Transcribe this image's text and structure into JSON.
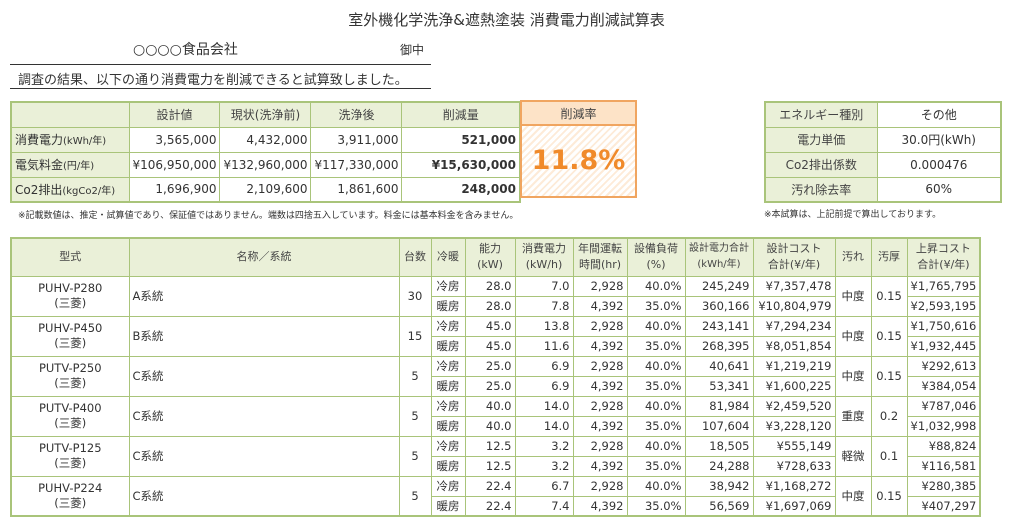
{
  "header": {
    "title": "室外機化学洗浄&遮熱塗装 消費電力削減試算表",
    "company": "○○○○食品会社",
    "onchu": "御中",
    "intro": "調査の結果、以下の通り消費電力を削減できると試算致しました。"
  },
  "summary": {
    "headers": [
      "設計値",
      "現状(洗浄前)",
      "洗浄後",
      "削減量"
    ],
    "rate_label": "削減率",
    "rate_value": "11.8%",
    "rows": [
      {
        "label": "消費電力",
        "unit": "(kWh/年)",
        "design": "3,565,000",
        "before": "4,432,000",
        "after": "3,911,000",
        "reduction": "521,000"
      },
      {
        "label": "電気料金",
        "unit": "(円/年)",
        "design": "¥106,950,000",
        "before": "¥132,960,000",
        "after": "¥117,330,000",
        "reduction": "¥15,630,000"
      },
      {
        "label": "Co2排出",
        "unit": "(kgCo2/年)",
        "design": "1,696,900",
        "before": "2,109,600",
        "after": "1,861,600",
        "reduction": "248,000"
      }
    ],
    "note": "※記載数値は、推定・試算値であり、保証値ではありません。端数は四捨五入しています。料金には基本料金を含みません。"
  },
  "energy": {
    "rows": [
      {
        "label": "エネルギー種別",
        "value": "その他"
      },
      {
        "label": "電力単価",
        "value": "30.0円(kWh)"
      },
      {
        "label": "Co2排出係数",
        "value": "0.000476"
      },
      {
        "label": "汚れ除去率",
        "value": "60%"
      }
    ],
    "note": "※本試算は、上記前提で算出しております。"
  },
  "detail": {
    "headers": {
      "model": "型式",
      "name": "名称／系統",
      "count": "台数",
      "mode": "冷暖",
      "capacity": "能力(kW)",
      "power": "消費電力(kW/h)",
      "hours": "年間運転時間(hr)",
      "load": "設備負荷(%)",
      "design_kwh": "設計電力合計(kWh/年)",
      "design_cost": "設計コスト合計(¥/年)",
      "dirt": "汚れ",
      "thickness": "汚厚",
      "increase": "上昇コスト合計(¥/年)"
    },
    "units": [
      {
        "model": "PUHV-P280",
        "maker": "(三菱)",
        "name": "A系統",
        "count": "30",
        "dirt": "中度",
        "thickness": "0.15",
        "rows": [
          {
            "mode": "冷房",
            "cap": "28.0",
            "power": "7.0",
            "hours": "2,928",
            "load": "40.0%",
            "kwh": "245,249",
            "cost": "¥7,357,478",
            "inc": "¥1,765,795"
          },
          {
            "mode": "暖房",
            "cap": "28.0",
            "power": "7.8",
            "hours": "4,392",
            "load": "35.0%",
            "kwh": "360,166",
            "cost": "¥10,804,979",
            "inc": "¥2,593,195"
          }
        ]
      },
      {
        "model": "PUHV-P450",
        "maker": "(三菱)",
        "name": "B系統",
        "count": "15",
        "dirt": "中度",
        "thickness": "0.15",
        "rows": [
          {
            "mode": "冷房",
            "cap": "45.0",
            "power": "13.8",
            "hours": "2,928",
            "load": "40.0%",
            "kwh": "243,141",
            "cost": "¥7,294,234",
            "inc": "¥1,750,616"
          },
          {
            "mode": "暖房",
            "cap": "45.0",
            "power": "11.6",
            "hours": "4,392",
            "load": "35.0%",
            "kwh": "268,395",
            "cost": "¥8,051,854",
            "inc": "¥1,932,445"
          }
        ]
      },
      {
        "model": "PUTV-P250",
        "maker": "(三菱)",
        "name": "C系統",
        "count": "5",
        "dirt": "中度",
        "thickness": "0.15",
        "rows": [
          {
            "mode": "冷房",
            "cap": "25.0",
            "power": "6.9",
            "hours": "2,928",
            "load": "40.0%",
            "kwh": "40,641",
            "cost": "¥1,219,219",
            "inc": "¥292,613"
          },
          {
            "mode": "暖房",
            "cap": "25.0",
            "power": "6.9",
            "hours": "4,392",
            "load": "35.0%",
            "kwh": "53,341",
            "cost": "¥1,600,225",
            "inc": "¥384,054"
          }
        ]
      },
      {
        "model": "PUTV-P400",
        "maker": "(三菱)",
        "name": "C系統",
        "count": "5",
        "dirt": "重度",
        "thickness": "0.2",
        "rows": [
          {
            "mode": "冷房",
            "cap": "40.0",
            "power": "14.0",
            "hours": "2,928",
            "load": "40.0%",
            "kwh": "81,984",
            "cost": "¥2,459,520",
            "inc": "¥787,046"
          },
          {
            "mode": "暖房",
            "cap": "40.0",
            "power": "14.0",
            "hours": "4,392",
            "load": "35.0%",
            "kwh": "107,604",
            "cost": "¥3,228,120",
            "inc": "¥1,032,998"
          }
        ]
      },
      {
        "model": "PUTV-P125",
        "maker": "(三菱)",
        "name": "C系統",
        "count": "5",
        "dirt": "軽微",
        "thickness": "0.1",
        "rows": [
          {
            "mode": "冷房",
            "cap": "12.5",
            "power": "3.2",
            "hours": "2,928",
            "load": "40.0%",
            "kwh": "18,505",
            "cost": "¥555,149",
            "inc": "¥88,824"
          },
          {
            "mode": "暖房",
            "cap": "12.5",
            "power": "3.2",
            "hours": "4,392",
            "load": "35.0%",
            "kwh": "24,288",
            "cost": "¥728,633",
            "inc": "¥116,581"
          }
        ]
      },
      {
        "model": "PUHV-P224",
        "maker": "(三菱)",
        "name": "C系統",
        "count": "5",
        "dirt": "中度",
        "thickness": "0.15",
        "rows": [
          {
            "mode": "冷房",
            "cap": "22.4",
            "power": "6.7",
            "hours": "2,928",
            "load": "40.0%",
            "kwh": "38,942",
            "cost": "¥1,168,272",
            "inc": "¥280,385"
          },
          {
            "mode": "暖房",
            "cap": "22.4",
            "power": "7.4",
            "hours": "4,392",
            "load": "35.0%",
            "kwh": "56,569",
            "cost": "¥1,697,069",
            "inc": "¥407,297"
          }
        ]
      }
    ]
  }
}
